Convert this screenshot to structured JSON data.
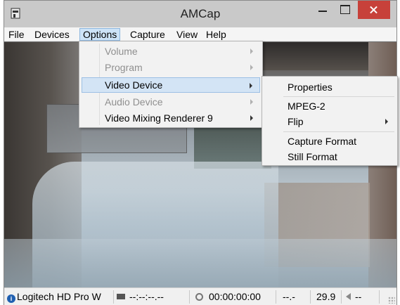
{
  "window": {
    "title": "AMCap"
  },
  "titlebar": {
    "icon": "amcap-app-icon",
    "buttons": [
      "minimize-icon",
      "maximize-icon",
      "close-icon"
    ],
    "close_color": "#c7413a"
  },
  "menubar": {
    "items": [
      {
        "label": "File"
      },
      {
        "label": "Devices"
      },
      {
        "label": "Options",
        "active": true
      },
      {
        "label": "Capture"
      },
      {
        "label": "View"
      },
      {
        "label": "Help"
      }
    ]
  },
  "options_menu": {
    "items": [
      {
        "label": "Volume",
        "enabled": false,
        "submenu": true
      },
      {
        "label": "Program",
        "enabled": false,
        "submenu": true
      },
      {
        "label": "Video Device",
        "enabled": true,
        "submenu": true,
        "highlighted": true
      },
      {
        "label": "Audio Device",
        "enabled": false,
        "submenu": true
      },
      {
        "label": "Video Mixing Renderer 9",
        "enabled": true,
        "submenu": true
      }
    ]
  },
  "video_device_submenu": {
    "items": [
      {
        "label": "Properties"
      },
      {
        "label": "MPEG-2"
      },
      {
        "label": "Flip",
        "submenu": true
      },
      {
        "label": "Capture Format"
      },
      {
        "label": "Still Format"
      }
    ]
  },
  "statusbar": {
    "device": "Logitech HD Pro W",
    "timecode": "--:--:--.--",
    "elapsed": "00:00:00:00",
    "dropped": "--.-",
    "fps": "29.9",
    "volume": "--"
  },
  "colors": {
    "menu_highlight": "#d3e4f5",
    "titlebar_bg": "#c9c9c9"
  }
}
